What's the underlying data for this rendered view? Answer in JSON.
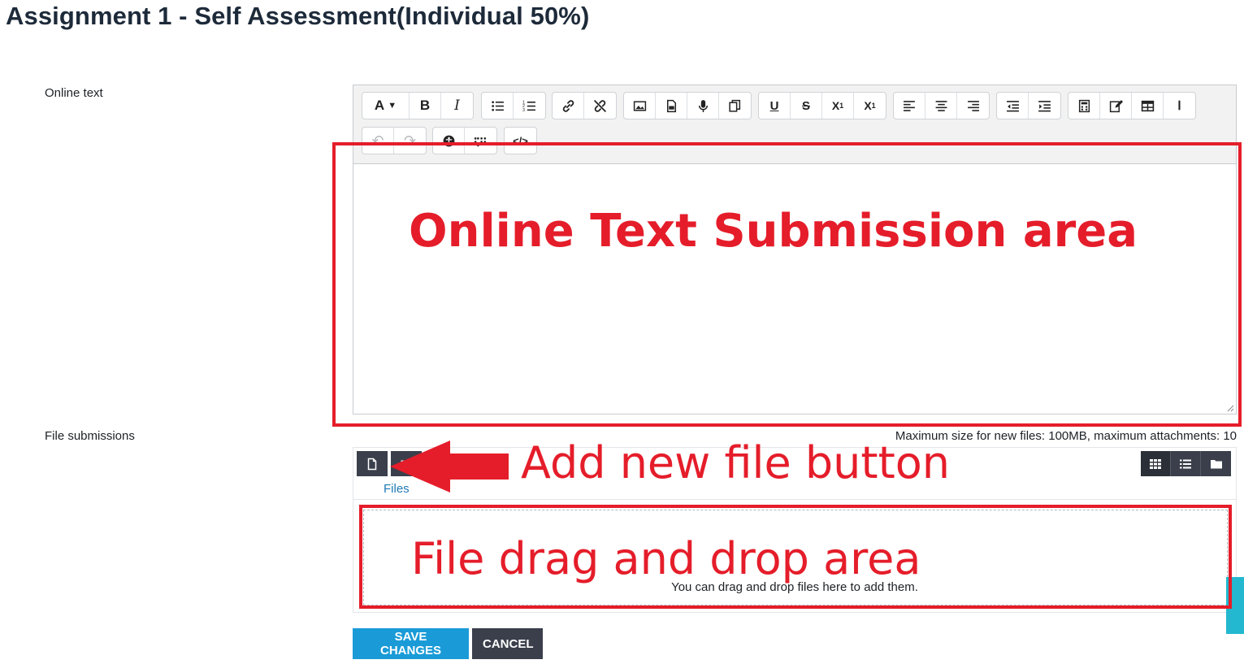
{
  "page": {
    "title": "Assignment 1 - Self Assessment(Individual 50%)"
  },
  "online_text": {
    "label": "Online text",
    "toolbar_row1": [
      {
        "name": "font-style-icon",
        "glyph": "A ▾"
      },
      {
        "name": "bold-icon",
        "glyph": "B"
      },
      {
        "name": "italic-icon",
        "glyph": "I"
      },
      {
        "name": "bullet-list-icon",
        "glyph": ""
      },
      {
        "name": "numbered-list-icon",
        "glyph": ""
      },
      {
        "name": "link-icon",
        "glyph": ""
      },
      {
        "name": "unlink-icon",
        "glyph": ""
      },
      {
        "name": "image-icon",
        "glyph": ""
      },
      {
        "name": "media-icon",
        "glyph": ""
      },
      {
        "name": "microphone-icon",
        "glyph": ""
      },
      {
        "name": "copy-icon",
        "glyph": ""
      },
      {
        "name": "underline-icon",
        "glyph": "U"
      },
      {
        "name": "strikethrough-icon",
        "glyph": "S"
      },
      {
        "name": "subscript-icon",
        "glyph": "X₁"
      },
      {
        "name": "superscript-icon",
        "glyph": "X¹"
      },
      {
        "name": "align-left-icon",
        "glyph": ""
      },
      {
        "name": "align-center-icon",
        "glyph": ""
      },
      {
        "name": "align-right-icon",
        "glyph": ""
      },
      {
        "name": "outdent-icon",
        "glyph": ""
      },
      {
        "name": "indent-icon",
        "glyph": ""
      },
      {
        "name": "calculator-icon",
        "glyph": ""
      },
      {
        "name": "edit-icon",
        "glyph": ""
      },
      {
        "name": "table-icon",
        "glyph": ""
      },
      {
        "name": "text-cursor-icon",
        "glyph": "Ⅰ"
      }
    ],
    "toolbar_row2": [
      {
        "name": "undo-icon",
        "glyph": "↶",
        "disabled": true
      },
      {
        "name": "redo-icon",
        "glyph": "↷",
        "disabled": true
      },
      {
        "name": "accessibility-icon",
        "glyph": ""
      },
      {
        "name": "braille-icon",
        "glyph": ""
      },
      {
        "name": "html-code-icon",
        "glyph": "</>"
      }
    ],
    "content": ""
  },
  "file_submissions": {
    "label": "File submissions",
    "limits": "Maximum size for new files: 100MB, maximum attachments: 10",
    "path": "Files",
    "dropzone_message": "You can drag and drop files here to add them."
  },
  "actions": {
    "save_label": "SAVE CHANGES",
    "cancel_label": "CANCEL"
  },
  "annotations": {
    "color": "#e51d2a",
    "online_text_area": "Online Text Submission area",
    "add_file_button": "Add new file button",
    "drag_drop_area": "File drag and drop area"
  },
  "colors": {
    "primary_button": "#1a9bd7",
    "secondary_button": "#3a3f4b",
    "link": "#1f7ab5",
    "side_tab": "#23b8cf"
  }
}
